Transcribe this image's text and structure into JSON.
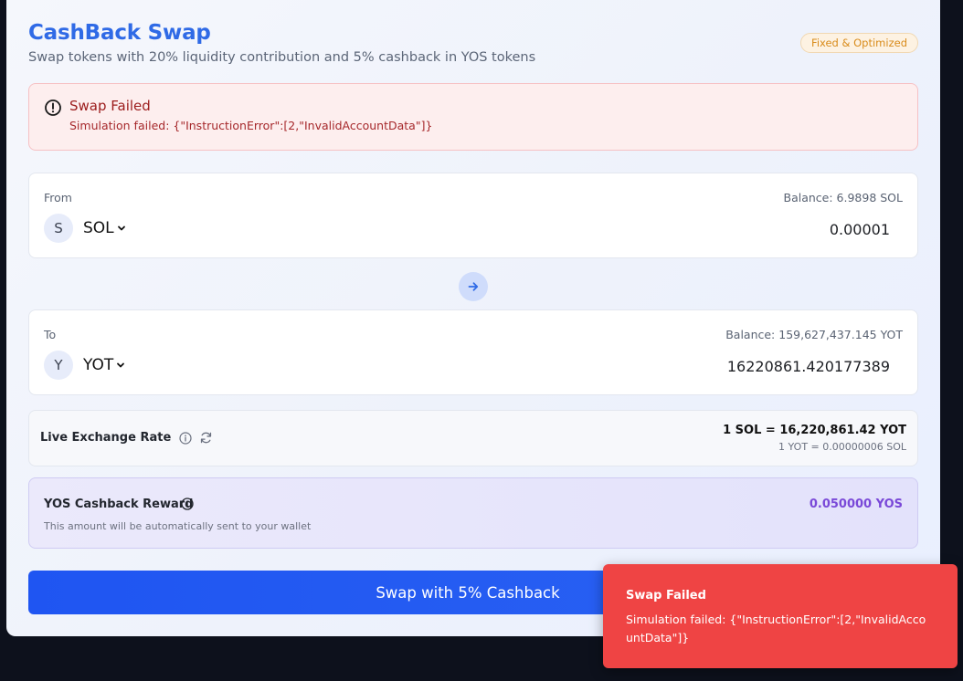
{
  "header": {
    "title": "CashBack Swap",
    "subtitle": "Swap tokens with 20% liquidity contribution and 5% cashback in YOS tokens",
    "badge": "Fixed & Optimized"
  },
  "alert": {
    "title": "Swap Failed",
    "message": "Simulation failed: {\"InstructionError\":[2,\"InvalidAccountData\"]}"
  },
  "from": {
    "label": "From",
    "balance": "Balance: 6.9898 SOL",
    "token_initial": "S",
    "token": "SOL",
    "amount": "0.00001"
  },
  "to": {
    "label": "To",
    "balance": "Balance: 159,627,437.145 YOT",
    "token_initial": "Y",
    "token": "YOT",
    "amount": "16220861.420177389"
  },
  "rate": {
    "label": "Live Exchange Rate",
    "main": "1 SOL = 16,220,861.42 YOT",
    "inverse": "1 YOT = 0.00000006 SOL"
  },
  "reward": {
    "label": "YOS Cashback Reward",
    "value": "0.050000 YOS",
    "note": "This amount will be automatically sent to your wallet"
  },
  "swap_button": {
    "label": "Swap with 5% Cashback"
  },
  "toast": {
    "title": "Swap Failed",
    "message": "Simulation failed: {\"InstructionError\":[2,\"InvalidAccountData\"]}"
  },
  "colors": {
    "title_blue": "#2f6ae6",
    "primary_button": "#1f55f2",
    "error_red": "#ef4444",
    "reward_purple": "#7a49d8",
    "badge_orange": "#d98c1c"
  },
  "icons": {
    "alert": "alert-circle-icon",
    "swap_direction": "arrow-right-icon",
    "info": "info-icon",
    "refresh": "refresh-icon",
    "dropdown": "chevron-down-icon"
  }
}
